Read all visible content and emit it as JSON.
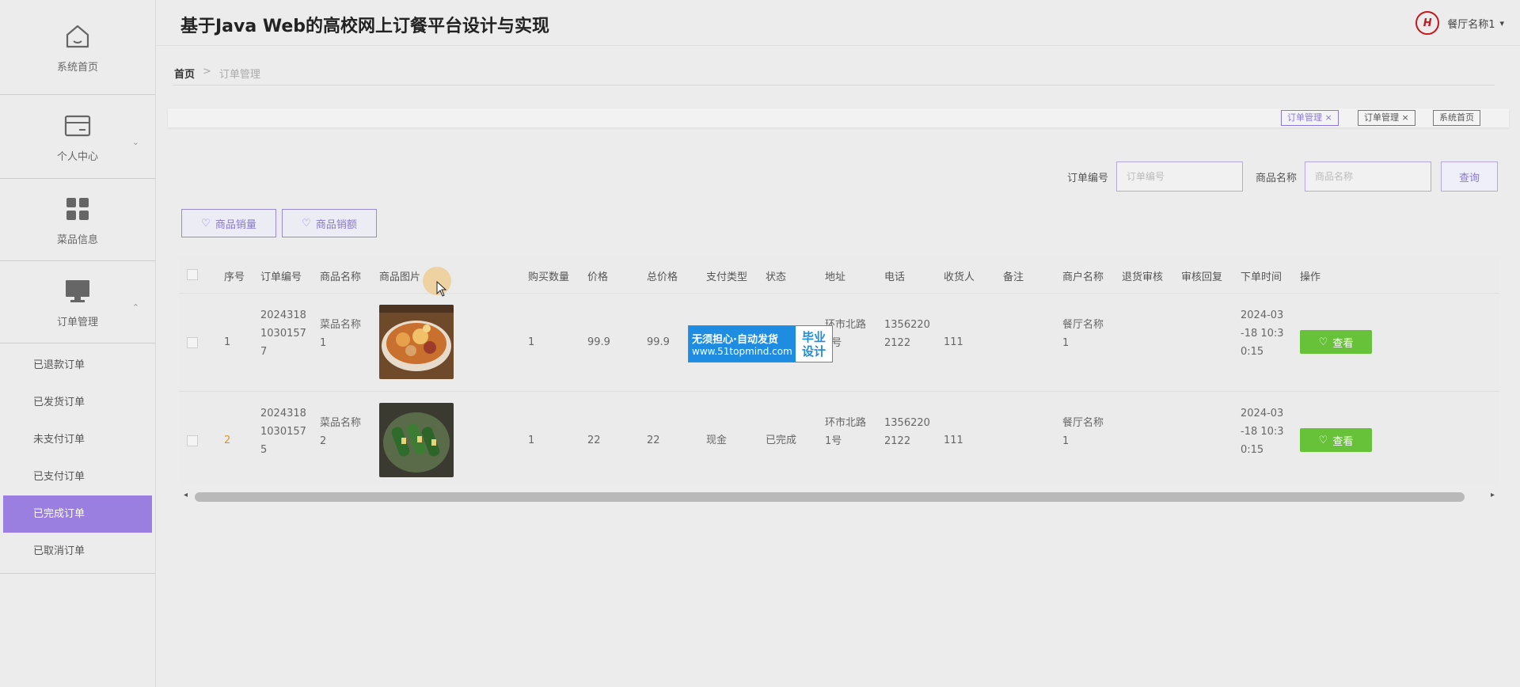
{
  "header": {
    "title": "基于Java Web的高校网上订餐平台设计与实现",
    "logo_text": "H",
    "user_name": "餐厅名称1",
    "user_caret": "▾"
  },
  "sidebar": {
    "home": "系统首页",
    "personal": "个人中心",
    "dishes": "菜品信息",
    "orders": "订单管理",
    "order_items": [
      {
        "label": "已退款订单"
      },
      {
        "label": "已发货订单"
      },
      {
        "label": "未支付订单"
      },
      {
        "label": "已支付订单"
      },
      {
        "label": "已完成订单"
      },
      {
        "label": "已取消订单"
      }
    ]
  },
  "breadcrumb": {
    "home": "首页",
    "sep": ">",
    "current": "订单管理"
  },
  "tags": [
    {
      "label": "订单管理 ×"
    },
    {
      "label": "订单管理 ×"
    },
    {
      "label": "系统首页"
    }
  ],
  "search": {
    "order_no_label": "订单编号",
    "order_no_placeholder": "订单编号",
    "product_label": "商品名称",
    "product_placeholder": "商品名称",
    "query_button": "查询"
  },
  "actions": {
    "sales_qty": "商品销量",
    "sales_amount": "商品销额"
  },
  "table": {
    "headers": {
      "seq": "序号",
      "order_no": "订单编号",
      "product": "商品名称",
      "image": "商品图片",
      "qty": "购买数量",
      "price": "价格",
      "total": "总价格",
      "pay_type": "支付类型",
      "status": "状态",
      "address": "地址",
      "phone": "电话",
      "receiver": "收货人",
      "remark": "备注",
      "merchant": "商户名称",
      "refund_review": "退货审核",
      "review_reply": "审核回复",
      "order_time": "下单时间",
      "ops": "操作"
    },
    "rows": [
      {
        "seq": "1",
        "order_no": [
          "2024318",
          "1030157",
          "7"
        ],
        "product": [
          "菜品名称",
          "1"
        ],
        "qty": "1",
        "price": "99.9",
        "total": "99.9",
        "pay_type": "",
        "status": "",
        "address": [
          "环市北路",
          "1号"
        ],
        "phone": [
          "1356220",
          "2122"
        ],
        "receiver": "111",
        "merchant": [
          "餐厅名称",
          "1"
        ],
        "order_time": [
          "2024-03",
          "-18 10:3",
          "0:15"
        ],
        "view": "查看"
      },
      {
        "seq": "2",
        "order_no": [
          "2024318",
          "1030157",
          "5"
        ],
        "product": [
          "菜品名称",
          "2"
        ],
        "qty": "1",
        "price": "22",
        "total": "22",
        "pay_type": "现金",
        "status": "已完成",
        "address": [
          "环市北路",
          "1号"
        ],
        "phone": [
          "1356220",
          "2122"
        ],
        "receiver": "111",
        "merchant": [
          "餐厅名称",
          "1"
        ],
        "order_time": [
          "2024-03",
          "-18 10:3",
          "0:15"
        ],
        "view": "查看"
      }
    ]
  },
  "watermark": {
    "line1": "无须担心·自动发货",
    "line2": "www.51topmind.com",
    "right1": "毕业",
    "right2": "设计"
  },
  "scroll": {
    "left": "◂",
    "right": "▸"
  },
  "colors": {
    "accent": "#9b7fe0",
    "view_button": "#67c23a",
    "watermark_blue": "#1e8ce0"
  }
}
